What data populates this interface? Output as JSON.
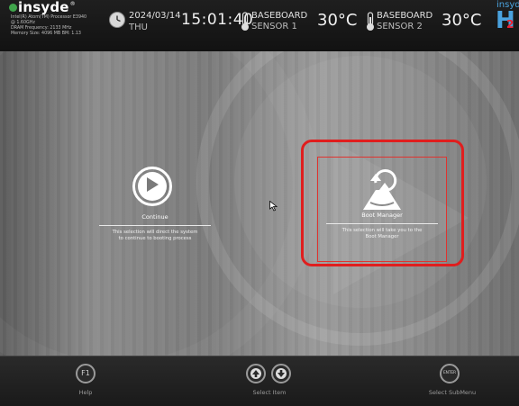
{
  "header": {
    "brand": "insyde",
    "brand_mark": "®",
    "system_info": [
      "Intel(R) Atom(TM) Processor E3940",
      "@ 1.60GHz",
      "DRAM Frequency: 2133 MHz",
      "Memory Size: 4096 MB BM: 1.13"
    ],
    "date": "2024/03/14",
    "day": "THU",
    "time": "15:01:40",
    "sensors": [
      {
        "line1": "BASEBOARD",
        "line2": "SENSOR 1",
        "temp": "30°C",
        "icon": "thermometer-icon"
      },
      {
        "line1": "BASEBOARD",
        "line2": "SENSOR 2",
        "temp": "30°C",
        "icon": "thermometer-icon"
      }
    ],
    "corner_logo": {
      "line1": "insyde",
      "big": "H",
      "small": "2"
    }
  },
  "main": {
    "options": [
      {
        "title": "Continue",
        "description": [
          "This selection will direct the system",
          "to continue to booting process"
        ],
        "icon": "play-icon",
        "selected": false
      },
      {
        "title": "Boot Manager",
        "description": [
          "This selection will take you to the",
          "Boot Manager"
        ],
        "icon": "boot-manager-icon",
        "selected": true
      }
    ]
  },
  "footer": {
    "keys": [
      {
        "key": "F1",
        "label": "Help"
      },
      {
        "key": "",
        "label": "Select Item"
      },
      {
        "key": "ENTER",
        "label": "Select  SubMenu"
      }
    ]
  },
  "colors": {
    "selection": "#e01e1e",
    "brand_green": "#3fa54b",
    "hdr_blue": "#4aa3df"
  }
}
